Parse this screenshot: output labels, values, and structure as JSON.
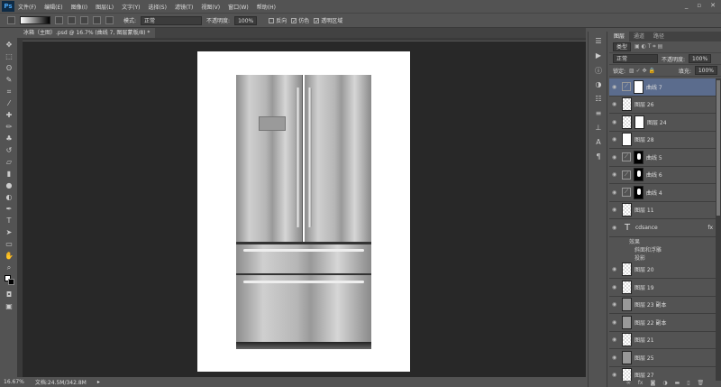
{
  "app": {
    "logo": "Ps"
  },
  "menu": [
    "文件(F)",
    "编辑(E)",
    "图像(I)",
    "图层(L)",
    "文字(Y)",
    "选择(S)",
    "滤镜(T)",
    "视图(V)",
    "窗口(W)",
    "帮助(H)"
  ],
  "window_controls": [
    "minimize",
    "restore",
    "close"
  ],
  "options": {
    "mode_label": "模式:",
    "mode_value": "正常",
    "opacity_label": "不透明度:",
    "opacity_value": "100%",
    "reverse": "反向",
    "dither": "仿色",
    "transparency": "透明区域",
    "dither_checked": true,
    "transparency_checked": true,
    "reverse_checked": false
  },
  "document_tab": "冰箱（主图）.psd @ 16.7% (曲线 7, 图层蒙版/8) *",
  "status": {
    "zoom": "16.67%",
    "doc": "文档:24.5M/342.8M"
  },
  "layers_panel": {
    "tabs": [
      "图层",
      "通道",
      "路径"
    ],
    "filter": "类型",
    "blend": "正常",
    "opacity_label": "不透明度:",
    "opacity": "100%",
    "lock_label": "锁定:",
    "fill_label": "填充:",
    "fill": "100%",
    "layers": [
      {
        "name": "曲线 7",
        "kind": "adj",
        "selected": true
      },
      {
        "name": "图层 26",
        "kind": "ck"
      },
      {
        "name": "图层 24",
        "kind": "ck-mask"
      },
      {
        "name": "图层 28",
        "kind": "white"
      },
      {
        "name": "曲线 5",
        "kind": "adj-black"
      },
      {
        "name": "曲线 6",
        "kind": "adj-black"
      },
      {
        "name": "曲线 4",
        "kind": "adj-black"
      },
      {
        "name": "图层 11",
        "kind": "ck"
      },
      {
        "name": "cdsance",
        "kind": "text",
        "fx": true
      },
      {
        "name": "图层 20",
        "kind": "ck"
      },
      {
        "name": "图层 19",
        "kind": "ck"
      },
      {
        "name": "图层 23 副本",
        "kind": "gray"
      },
      {
        "name": "图层 22 副本",
        "kind": "gray"
      },
      {
        "name": "图层 21",
        "kind": "ck"
      },
      {
        "name": "图层 25",
        "kind": "gray"
      },
      {
        "name": "图层 27",
        "kind": "ck"
      }
    ],
    "effects": {
      "title": "效果",
      "items": [
        "斜面和浮雕",
        "投影"
      ]
    }
  }
}
